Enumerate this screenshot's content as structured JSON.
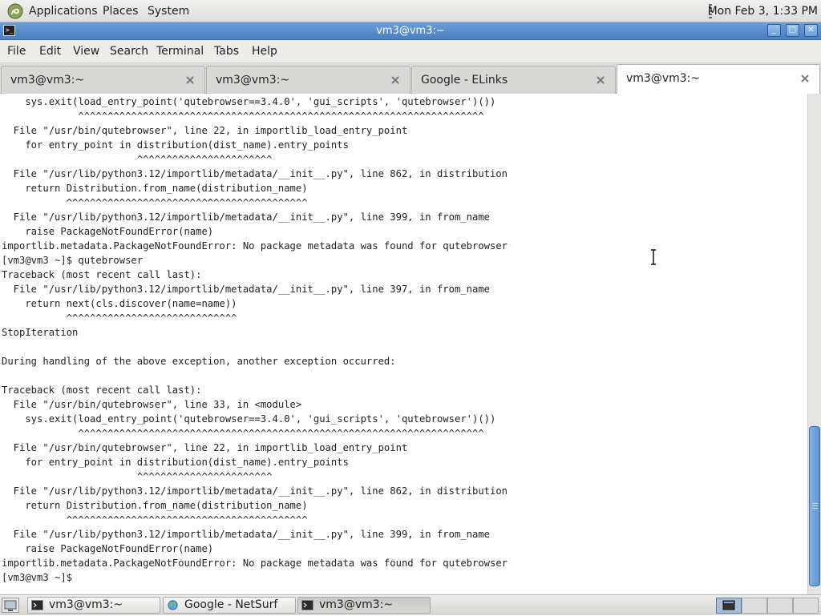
{
  "top_panel": {
    "menus": [
      "Applications",
      "Places",
      "System"
    ],
    "clock": "Mon Feb  3,  1:33 PM"
  },
  "window": {
    "title": "vm3@vm3:~",
    "controls": {
      "minimize": "_",
      "maximize": "□",
      "close": "✕"
    }
  },
  "menubar": [
    "File",
    "Edit",
    "View",
    "Search",
    "Terminal",
    "Tabs",
    "Help"
  ],
  "tabs": [
    {
      "label": "vm3@vm3:~",
      "active": false
    },
    {
      "label": "vm3@vm3:~",
      "active": false
    },
    {
      "label": "Google - ELinks",
      "active": false
    },
    {
      "label": "vm3@vm3:~",
      "active": true
    }
  ],
  "terminal": {
    "lines": [
      "    sys.exit(load_entry_point('qutebrowser==3.4.0', 'gui_scripts', 'qutebrowser')())",
      "             ^^^^^^^^^^^^^^^^^^^^^^^^^^^^^^^^^^^^^^^^^^^^^^^^^^^^^^^^^^^^^^^^^^^^^",
      "  File \"/usr/bin/qutebrowser\", line 22, in importlib_load_entry_point",
      "    for entry_point in distribution(dist_name).entry_points",
      "                       ^^^^^^^^^^^^^^^^^^^^^^^",
      "  File \"/usr/lib/python3.12/importlib/metadata/__init__.py\", line 862, in distribution",
      "    return Distribution.from_name(distribution_name)",
      "           ^^^^^^^^^^^^^^^^^^^^^^^^^^^^^^^^^^^^^^^^^",
      "  File \"/usr/lib/python3.12/importlib/metadata/__init__.py\", line 399, in from_name",
      "    raise PackageNotFoundError(name)",
      "importlib.metadata.PackageNotFoundError: No package metadata was found for qutebrowser",
      "[vm3@vm3 ~]$ qutebrowser",
      "Traceback (most recent call last):",
      "  File \"/usr/lib/python3.12/importlib/metadata/__init__.py\", line 397, in from_name",
      "    return next(cls.discover(name=name))",
      "           ^^^^^^^^^^^^^^^^^^^^^^^^^^^^^",
      "StopIteration",
      "",
      "During handling of the above exception, another exception occurred:",
      "",
      "Traceback (most recent call last):",
      "  File \"/usr/bin/qutebrowser\", line 33, in <module>",
      "    sys.exit(load_entry_point('qutebrowser==3.4.0', 'gui_scripts', 'qutebrowser')())",
      "             ^^^^^^^^^^^^^^^^^^^^^^^^^^^^^^^^^^^^^^^^^^^^^^^^^^^^^^^^^^^^^^^^^^^^^",
      "  File \"/usr/bin/qutebrowser\", line 22, in importlib_load_entry_point",
      "    for entry_point in distribution(dist_name).entry_points",
      "                       ^^^^^^^^^^^^^^^^^^^^^^^",
      "  File \"/usr/lib/python3.12/importlib/metadata/__init__.py\", line 862, in distribution",
      "    return Distribution.from_name(distribution_name)",
      "           ^^^^^^^^^^^^^^^^^^^^^^^^^^^^^^^^^^^^^^^^^",
      "  File \"/usr/lib/python3.12/importlib/metadata/__init__.py\", line 399, in from_name",
      "    raise PackageNotFoundError(name)",
      "importlib.metadata.PackageNotFoundError: No package metadata was found for qutebrowser",
      "[vm3@vm3 ~]$ "
    ]
  },
  "taskbar": {
    "tasks": [
      {
        "label": "vm3@vm3:~",
        "icon": "terminal-icon",
        "active": false
      },
      {
        "label": "Google - NetSurf",
        "icon": "globe-icon",
        "active": false
      },
      {
        "label": "vm3@vm3:~",
        "icon": "terminal-icon",
        "active": true
      }
    ],
    "workspaces": 4,
    "active_workspace": 1
  },
  "colors": {
    "titlebar": "#4a7fc2",
    "scroll_thumb": "#5e92d0",
    "terminal_bg": "#ffffff",
    "terminal_fg": "#1f1f1f"
  }
}
